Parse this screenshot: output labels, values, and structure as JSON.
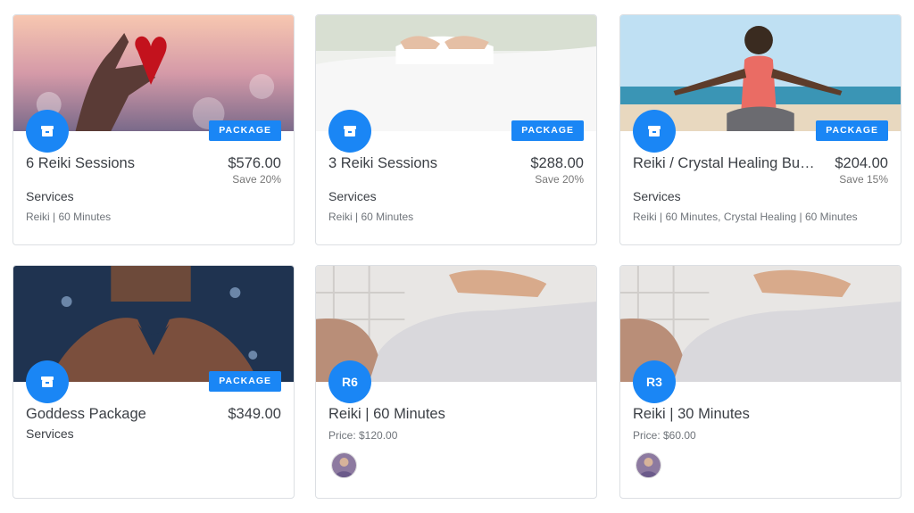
{
  "cards": [
    {
      "title": "6 Reiki Sessions",
      "price": "$576.00",
      "save": "Save 20%",
      "badge": "PACKAGE",
      "category": "Services",
      "meta": "Reiki | 60 Minutes"
    },
    {
      "title": "3 Reiki Sessions",
      "price": "$288.00",
      "save": "Save 20%",
      "badge": "PACKAGE",
      "category": "Services",
      "meta": "Reiki | 60 Minutes"
    },
    {
      "title": "Reiki / Crystal Healing Bun...",
      "price": "$204.00",
      "save": "Save 15%",
      "badge": "PACKAGE",
      "category": "Services",
      "meta": "Reiki | 60 Minutes,  Crystal Healing | 60 Minutes"
    },
    {
      "title": "Goddess Package",
      "price": "$349.00",
      "badge": "PACKAGE",
      "category": "Services"
    },
    {
      "title": "Reiki | 60 Minutes",
      "initials": "R6",
      "price_text": "Price: $120.00"
    },
    {
      "title": "Reiki | 30 Minutes",
      "initials": "R3",
      "price_text": "Price: $60.00"
    }
  ],
  "colors": {
    "accent": "#1a86f5",
    "border": "#dcdfe3",
    "text": "#3b3f45"
  },
  "icons": {
    "package": "archive-box-icon",
    "avatar": "practitioner-avatar"
  }
}
